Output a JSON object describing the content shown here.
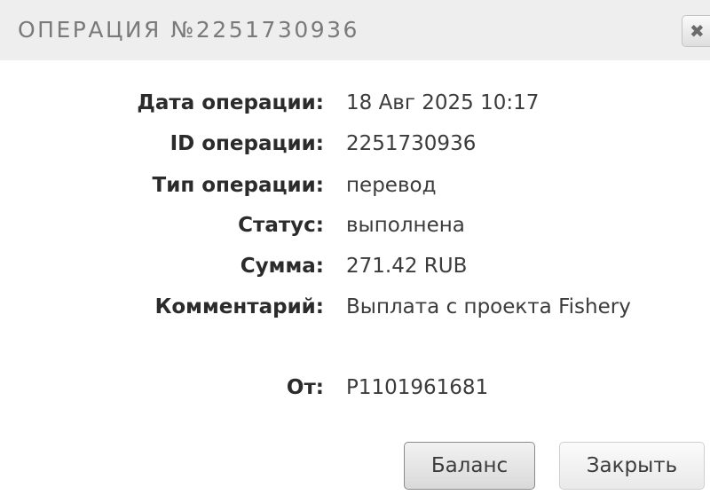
{
  "dialog": {
    "title": "ОПЕРАЦИЯ №2251730936",
    "close_glyph": "✖"
  },
  "fields": [
    {
      "label": "Дата операции:",
      "value": "18 Авг 2025 10:17"
    },
    {
      "label": "ID операции:",
      "value": "2251730936"
    },
    {
      "label": "Тип операции:",
      "value": "перевод"
    },
    {
      "label": "Статус:",
      "value": "выполнена"
    },
    {
      "label": "Сумма:",
      "value": "271.42 RUB"
    },
    {
      "label": "Комментарий:",
      "value": "Выплата с проекта Fishery"
    },
    {
      "label": "От:",
      "value": "P1101961681"
    }
  ],
  "buttons": {
    "balance": "Баланс",
    "close": "Закрыть"
  }
}
